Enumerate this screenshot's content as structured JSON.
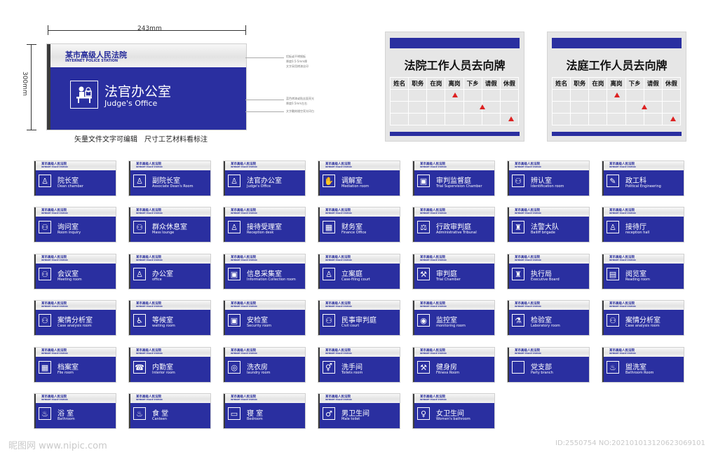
{
  "main_sign": {
    "width_label": "243mm",
    "height_label": "300mm",
    "court": "某市高级人民法院",
    "court_en": "INTERNET POLICE STATION",
    "room_cn": "法官办公室",
    "room_en": "Judge's Office",
    "icon": "judge-desk-icon",
    "notes": [
      "铝板或不锈钢板",
      "厚度0.5-5mm厚",
      "文字采用烤漆丝印",
      "蓝色烤漆或贴丝面亮光",
      "厚度0.5mm左右",
      "文字雕刻镂空亮光印白"
    ]
  },
  "caption": "矢量文件文字可编辑　尺寸工艺材料看标注",
  "boards": [
    {
      "title": "法院工作人员去向牌",
      "headers": [
        "姓名",
        "职务",
        "在岗",
        "离岗",
        "下乡",
        "请假",
        "休假"
      ]
    },
    {
      "title": "法庭工作人员去向牌",
      "headers": [
        "姓名",
        "职务",
        "在岗",
        "离岗",
        "下乡",
        "请假",
        "休假"
      ]
    }
  ],
  "small_sign_court": "某市高级人民法院",
  "small_sign_court_en": "INTERNET POLICE STATION",
  "signs": [
    {
      "cn": "院长室",
      "en": "Dean chamber",
      "icon": "♙"
    },
    {
      "cn": "副院长室",
      "en": "Associate Dean's Room",
      "icon": "♙"
    },
    {
      "cn": "法官办公室",
      "en": "Judge's Office",
      "icon": "♙"
    },
    {
      "cn": "调解室",
      "en": "Mediation room",
      "icon": "✋"
    },
    {
      "cn": "审判监督庭",
      "en": "Trial Supervision Chamber",
      "icon": "▣"
    },
    {
      "cn": "辨认室",
      "en": "Identification room",
      "icon": "⚇"
    },
    {
      "cn": "政工科",
      "en": "Political Engineering",
      "icon": "✎"
    },
    {
      "cn": "询问室",
      "en": "Room inquiry",
      "icon": "⚇"
    },
    {
      "cn": "群众休息室",
      "en": "Mass lounge",
      "icon": "⚇"
    },
    {
      "cn": "接待受理室",
      "en": "Reception desk",
      "icon": "♙"
    },
    {
      "cn": "财务室",
      "en": "Finance Office",
      "icon": "▦"
    },
    {
      "cn": "行政审判庭",
      "en": "Administrative Tribunal",
      "icon": "⚖"
    },
    {
      "cn": "法警大队",
      "en": "Bailiff brigade",
      "icon": "♜"
    },
    {
      "cn": "接待厅",
      "en": "reception hall",
      "icon": "♙"
    },
    {
      "cn": "会议室",
      "en": "Meeting room",
      "icon": "⚇"
    },
    {
      "cn": "办公室",
      "en": "office",
      "icon": "♙"
    },
    {
      "cn": "信息采集室",
      "en": "Information Collection room",
      "icon": "▣"
    },
    {
      "cn": "立案庭",
      "en": "Case-filing court",
      "icon": "♙"
    },
    {
      "cn": "审判庭",
      "en": "Trial Chamber",
      "icon": "⚒"
    },
    {
      "cn": "执行局",
      "en": "Executive Board",
      "icon": "♜"
    },
    {
      "cn": "阅览室",
      "en": "Reading room",
      "icon": "▤"
    },
    {
      "cn": "案情分析室",
      "en": "Case analysis room",
      "icon": "⚇"
    },
    {
      "cn": "等候室",
      "en": "waiting room",
      "icon": "♿"
    },
    {
      "cn": "安检室",
      "en": "Security room",
      "icon": "▣"
    },
    {
      "cn": "民事审判庭",
      "en": "Civil court",
      "icon": "⚇"
    },
    {
      "cn": "监控室",
      "en": "monitoring room",
      "icon": "◉"
    },
    {
      "cn": "检验室",
      "en": "Laboratory room",
      "icon": "⚗"
    },
    {
      "cn": "案情分析室",
      "en": "Case analysis room",
      "icon": "⚇"
    },
    {
      "cn": "档案室",
      "en": "File room",
      "icon": "▦"
    },
    {
      "cn": "内勤室",
      "en": "Interior room",
      "icon": "☎"
    },
    {
      "cn": "洗衣房",
      "en": "laundry room",
      "icon": "◎"
    },
    {
      "cn": "洗手间",
      "en": "Toilets room",
      "icon": "⚥"
    },
    {
      "cn": "健身房",
      "en": "Fitness Room",
      "icon": "⚒"
    },
    {
      "cn": "党支部",
      "en": "Party branch",
      "icon": ""
    },
    {
      "cn": "盥洗室",
      "en": "Bathroom Room",
      "icon": "♨"
    },
    {
      "cn": "浴 室",
      "en": "Bathroom",
      "icon": "♨"
    },
    {
      "cn": "食 堂",
      "en": "Canteen",
      "icon": "♨"
    },
    {
      "cn": "寝 室",
      "en": "Bedroom",
      "icon": "▭"
    },
    {
      "cn": "男卫生间",
      "en": "Male toilet",
      "icon": "♂"
    },
    {
      "cn": "女卫生间",
      "en": "Women's bathroom",
      "icon": "♀"
    }
  ],
  "watermark_left": "昵图网 www.nipic.com",
  "watermark_right": "ID:2550754 NO:20210101312062306910​1"
}
